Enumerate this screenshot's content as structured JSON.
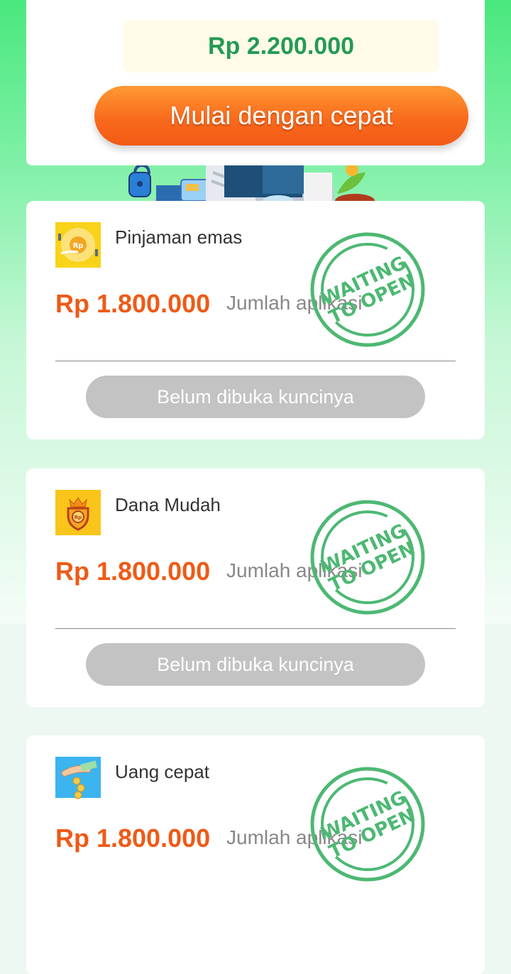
{
  "top": {
    "amount": "Rp 2.200.000",
    "start_button": "Mulai dengan cepat"
  },
  "stamp": {
    "line1": "WAITING",
    "line2": "TO OPEN"
  },
  "loans": [
    {
      "name": "Pinjaman emas",
      "amount": "Rp 1.800.000",
      "sublabel": "Jumlah aplikasi",
      "button": "Belum dibuka kuncinya",
      "icon": "gold-coin-hands-icon"
    },
    {
      "name": "Dana Mudah",
      "amount": "Rp 1.800.000",
      "sublabel": "Jumlah aplikasi",
      "button": "Belum dibuka kuncinya",
      "icon": "crown-shield-icon"
    },
    {
      "name": "Uang cepat",
      "amount": "Rp 1.800.000",
      "sublabel": "Jumlah aplikasi",
      "button": "",
      "icon": "hand-coins-icon"
    }
  ],
  "colors": {
    "accent_green": "#249a55",
    "amount_orange": "#ee5a16",
    "stamp_green": "#4db873",
    "button_orange": "#f96a1c"
  }
}
